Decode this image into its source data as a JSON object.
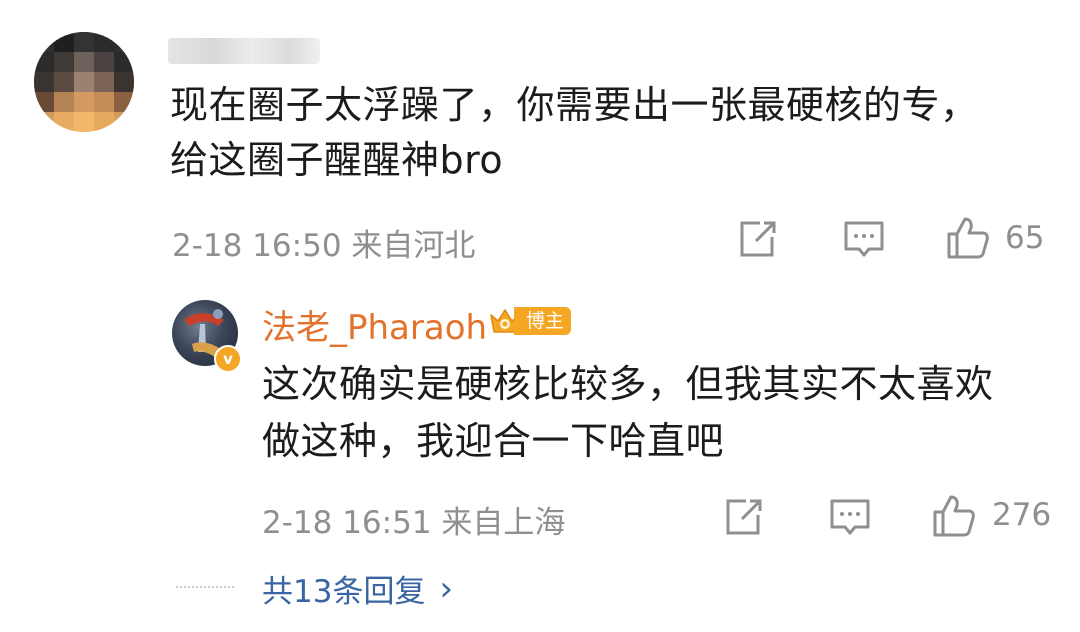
{
  "comment": {
    "avatar_icon": "blurred-avatar",
    "username_blurred": true,
    "text_line1": "现在圈子太浮躁了，你需要出一张最硬核的专，",
    "text_line2": "给这圈子醒醒神bro",
    "meta": "2-18 16:50  来自河北",
    "likes": "65",
    "icons": [
      "share-icon",
      "comment-icon",
      "like-icon"
    ]
  },
  "reply": {
    "author": "法老_Pharaoh",
    "author_color": "#e3722c",
    "badge_label": "博主",
    "verified_mark": "v",
    "text_line1": "这次确实是硬核比较多，但我其实不太喜欢",
    "text_line2": "做这种，我迎合一下哈直吧",
    "meta": "2-18 16:51  来自上海",
    "likes": "276"
  },
  "more_replies": {
    "label": "共13条回复",
    "chevron": "›",
    "link_color": "#3a64a4"
  }
}
